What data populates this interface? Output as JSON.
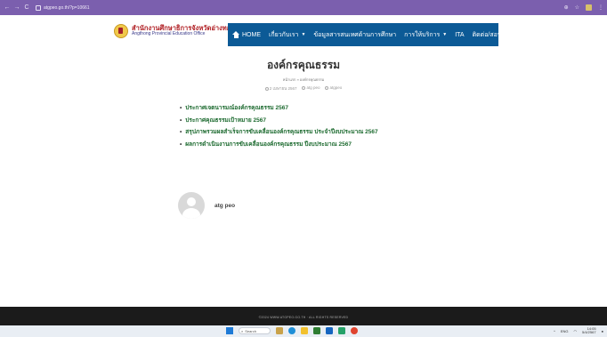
{
  "browser": {
    "url": "atgpeo.go.th/?p=10661",
    "nav_back": "←",
    "nav_forward": "→",
    "nav_reload": "C"
  },
  "header": {
    "org_name_th": "สำนักงานศึกษาธิการจังหวัดอ่างทอง",
    "org_name_en": "Angthong Provincial Education Office",
    "menu": [
      {
        "label": "HOME",
        "icon": "home-icon",
        "dropdown": false
      },
      {
        "label": "เกี่ยวกับเรา",
        "dropdown": true
      },
      {
        "label": "ข้อมูลสารสนเทศด้านการศึกษา",
        "dropdown": false
      },
      {
        "label": "การให้บริการ",
        "dropdown": true
      },
      {
        "label": "ITA",
        "dropdown": false
      },
      {
        "label": "ติดต่อ/สอบถาม",
        "dropdown": false
      }
    ]
  },
  "page": {
    "title": "องค์กรคุณธรรม",
    "breadcrumb": "หน้าแรก » องค์กรคุณธรรม",
    "meta_date": "2 เมษายน 2567",
    "meta_author": "atg peo",
    "meta_category": "atgpeo"
  },
  "links": [
    "ประกาศเจตนารมณ์องค์กรคุณธรรม 2567",
    "ประกาศคุณธรรมเป้าหมาย 2567",
    "สรุปภาพรวมผลสำเร็จการขับเคลื่อนองค์กรคุณธรรม ประจำปีงบประมาณ 2567",
    "ผลการดำเนินงานการขับเคลื่อนองค์กรคุณธรรม ปีงบประมาณ 2567"
  ],
  "author": {
    "name": "atg peo"
  },
  "footer": {
    "text": "©2024 WWW.ATGPEO.GO.TH  ·  ALL RIGHTS RESERVED"
  },
  "taskbar": {
    "search_placeholder": "Search",
    "lang": "ENG",
    "time": "14:05",
    "date": "5/4/2567"
  },
  "colors": {
    "chrome": "#7b5fae",
    "menu_bg": "#0c5a96",
    "link": "#1c6a2f",
    "footer_bg": "#1b1b1b"
  }
}
